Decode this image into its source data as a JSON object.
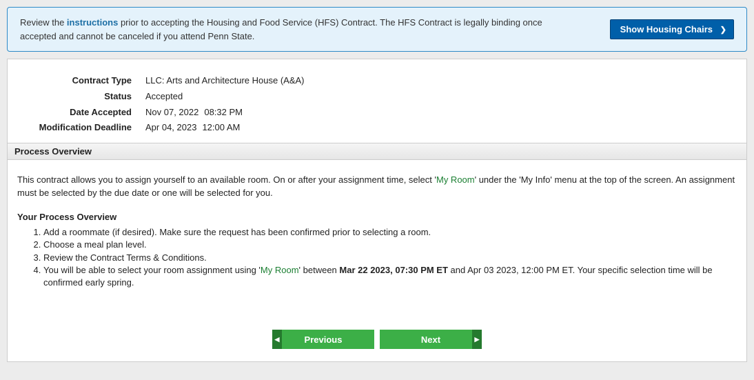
{
  "banner": {
    "text_pre": "Review the ",
    "link_text": "instructions",
    "text_post": " prior to accepting the Housing and Food Service (HFS) Contract. The HFS Contract is legally binding once accepted and cannot be canceled if you attend Penn State.",
    "button_label": "Show Housing Chairs"
  },
  "details": {
    "contract_type_label": "Contract Type",
    "contract_type_value": "LLC: Arts and Architecture House (A&A)",
    "status_label": "Status",
    "status_value": "Accepted",
    "date_accepted_label": "Date Accepted",
    "date_accepted_date": "Nov 07, 2022",
    "date_accepted_time": "08:32 PM",
    "mod_deadline_label": "Modification Deadline",
    "mod_deadline_date": "Apr 04, 2023",
    "mod_deadline_time": "12:00 AM"
  },
  "section_header": "Process Overview",
  "paragraph": {
    "p1_a": "This contract allows you to assign yourself to an available room. On or after your assignment time, select '",
    "p1_link": "My Room",
    "p1_b": "' under the 'My Info' menu at the top of the screen. An assignment must be selected by the due date or one will be selected for you."
  },
  "your_process_title": "Your Process Overview",
  "steps": {
    "s1": "Add a roommate (if desired). Make sure the request has been confirmed prior to selecting a room.",
    "s2": "Choose a meal plan level.",
    "s3": "Review the Contract Terms & Conditions.",
    "s4a": "You will be able to select your room assignment using '",
    "s4_link": "My Room",
    "s4b": "' between ",
    "s4_bold": "Mar 22 2023, 07:30 PM ET",
    "s4c": " and Apr 03 2023, 12:00 PM ET. Your specific selection time will be confirmed early spring."
  },
  "buttons": {
    "previous": "Previous",
    "next": "Next"
  }
}
